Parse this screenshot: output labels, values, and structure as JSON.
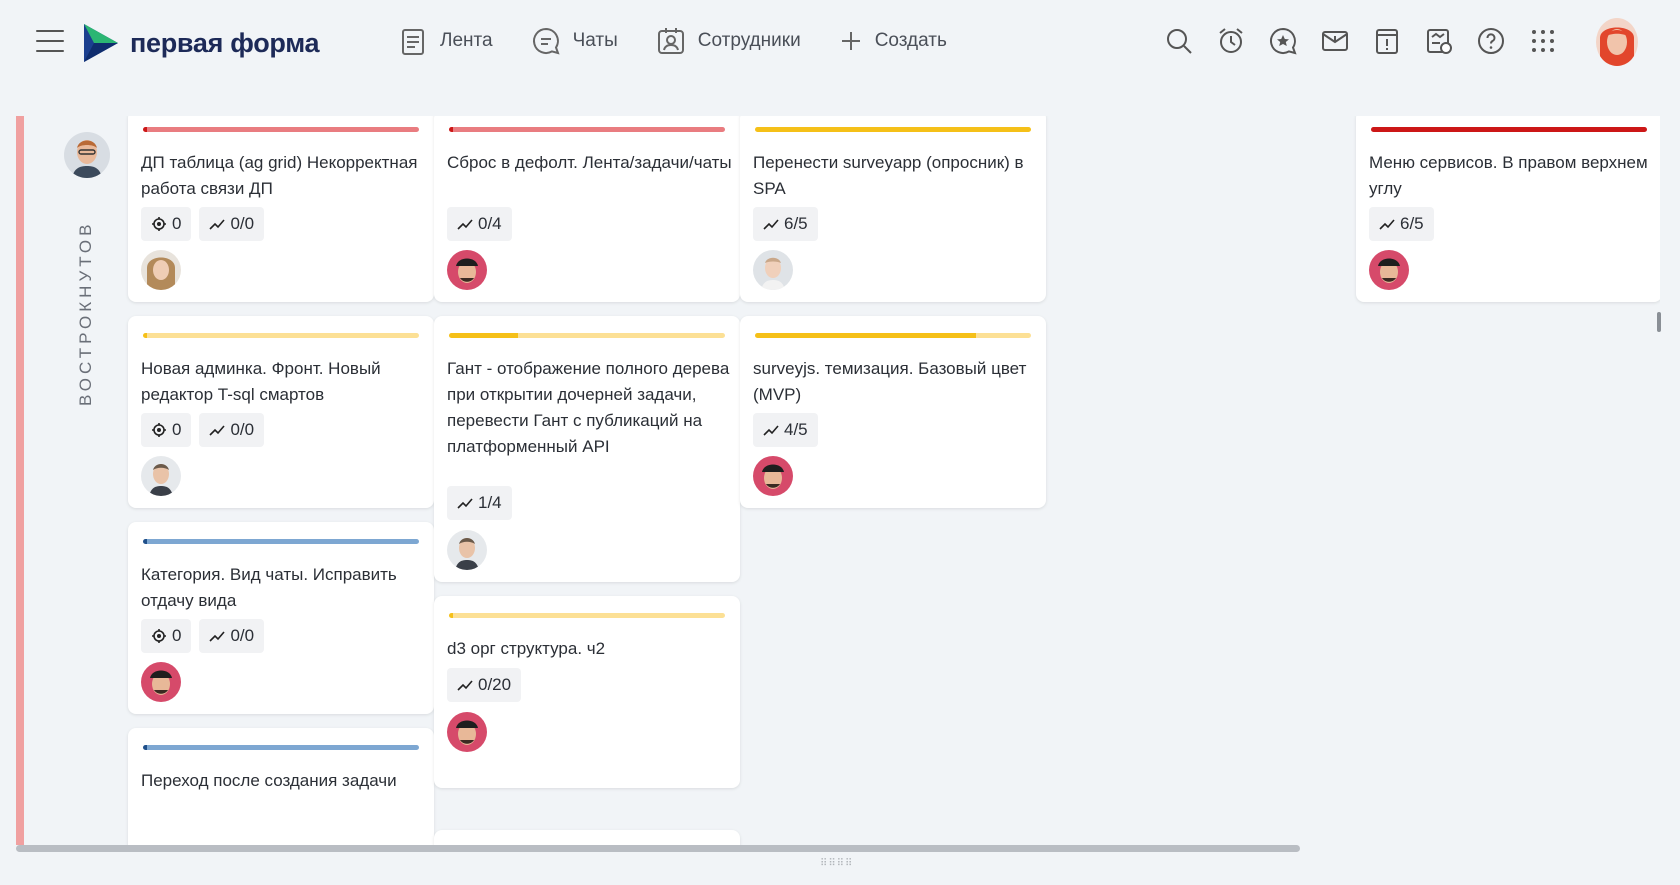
{
  "app": {
    "logo_text": "первая форма"
  },
  "nav": [
    {
      "label": "Лента",
      "icon": "feed-icon"
    },
    {
      "label": "Чаты",
      "icon": "chat-icon"
    },
    {
      "label": "Сотрудники",
      "icon": "employees-icon"
    },
    {
      "label": "Создать",
      "icon": "plus-icon"
    }
  ],
  "tools": [
    "search-icon",
    "alarm-icon",
    "favorites-icon",
    "notifications-icon",
    "tasks-alert-icon",
    "reports-icon",
    "help-icon",
    "apps-grid-icon"
  ],
  "lane": {
    "title": "ВОСТРОКНУТОВ",
    "color": "#f0a0a0"
  },
  "cards": [
    {
      "title": "ДП таблица (ag grid) Некорректная работа связи ДП",
      "bar_color": "#e97c80",
      "bar_progress": 0.0,
      "comments": "0",
      "progress": "0/0"
    },
    {
      "title": "Новая админка. Фронт. Новый редактор T-sql смартов",
      "bar_color": "#fce095",
      "bar_progress": 0.0,
      "comments": "0",
      "progress": "0/0"
    },
    {
      "title": "Категория. Вид чаты. Исправить отдачу вида",
      "bar_color": "#7da7d2",
      "bar_progress": 0.0,
      "comments": "0",
      "progress": "0/0"
    },
    {
      "title": "Переход после создания задачи",
      "bar_color": "#7da7d2",
      "bar_progress": 0.0
    },
    {
      "title": "Сброс в дефолт. Лента/задачи/чаты",
      "bar_color": "#e97c80",
      "bar_progress": 0.0,
      "progress": "0/4"
    },
    {
      "title": "Гант - отображение полного дерева при открытии дочерней задачи, перевести Гант с публикаций на платформенный API",
      "bar_color": "#fce095",
      "bar_progress": 0.25,
      "progress": "1/4"
    },
    {
      "title": "d3 орг структура. ч2",
      "bar_color": "#fce095",
      "bar_progress": 0.0,
      "progress": "0/20"
    },
    {
      "title": "Перенести surveyapp (опросник) в SPA",
      "bar_color": "#f5c018",
      "bar_progress": 1.0,
      "progress": "6/5"
    },
    {
      "title": "surveyjs. темизация. Базовый цвет (MVP)",
      "bar_color": "#fce095",
      "bar_progress": 0.8,
      "progress": "4/5"
    },
    {
      "title": "Меню сервисов. В правом верхнем углу",
      "bar_color": "#cc1717",
      "bar_progress": 1.0,
      "progress": "6/5"
    }
  ]
}
